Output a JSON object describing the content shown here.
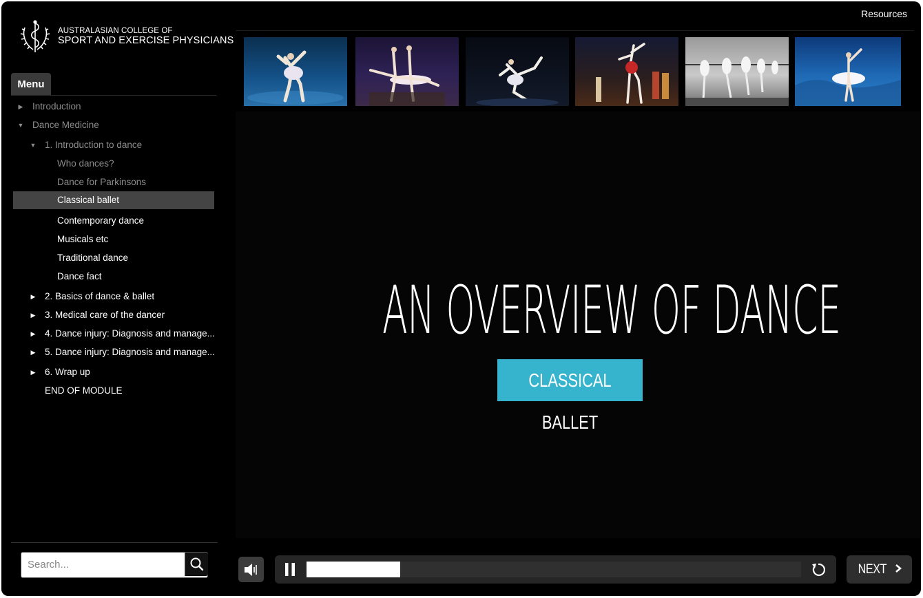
{
  "header": {
    "logo_line1": "AUSTRALASIAN COLLEGE OF",
    "logo_line2": "SPORT AND EXERCISE PHYSICIANS",
    "resources_label": "Resources"
  },
  "sidebar": {
    "menu_label": "Menu",
    "items": [
      {
        "label": "Introduction",
        "arrow": "▶"
      },
      {
        "label": "Dance Medicine",
        "arrow": "▼"
      },
      {
        "label": "1. Introduction to dance",
        "arrow": "▼"
      },
      {
        "label": "Who dances?"
      },
      {
        "label": "Dance for Parkinsons"
      },
      {
        "label": "Classical ballet"
      },
      {
        "label": "Contemporary dance"
      },
      {
        "label": "Musicals etc"
      },
      {
        "label": "Traditional dance"
      },
      {
        "label": "Dance fact"
      },
      {
        "label": "2. Basics of dance & ballet",
        "arrow": "▶"
      },
      {
        "label": "3. Medical care of the dancer",
        "arrow": "▶"
      },
      {
        "label": "4. Dance injury: Diagnosis and manage...",
        "arrow": "▶"
      },
      {
        "label": "5. Dance injury: Diagnosis and manage...",
        "arrow": "▶"
      },
      {
        "label": "6. Wrap up",
        "arrow": "▶"
      },
      {
        "label": "END OF MODULE"
      }
    ],
    "selected": "Classical ballet",
    "search": {
      "placeholder": "Search...",
      "value": ""
    }
  },
  "slide": {
    "title": "AN OVERVIEW OF DANCE",
    "subtitle": "CLASSICAL BALLET",
    "accent_color": "#37b4cd"
  },
  "player": {
    "volume_icon": "speaker-icon",
    "pause_icon": "pause-icon",
    "replay_icon": "replay-icon",
    "progress_fraction": 0.19,
    "next_label": "NEXT",
    "next_icon": "chevron-right-icon"
  }
}
